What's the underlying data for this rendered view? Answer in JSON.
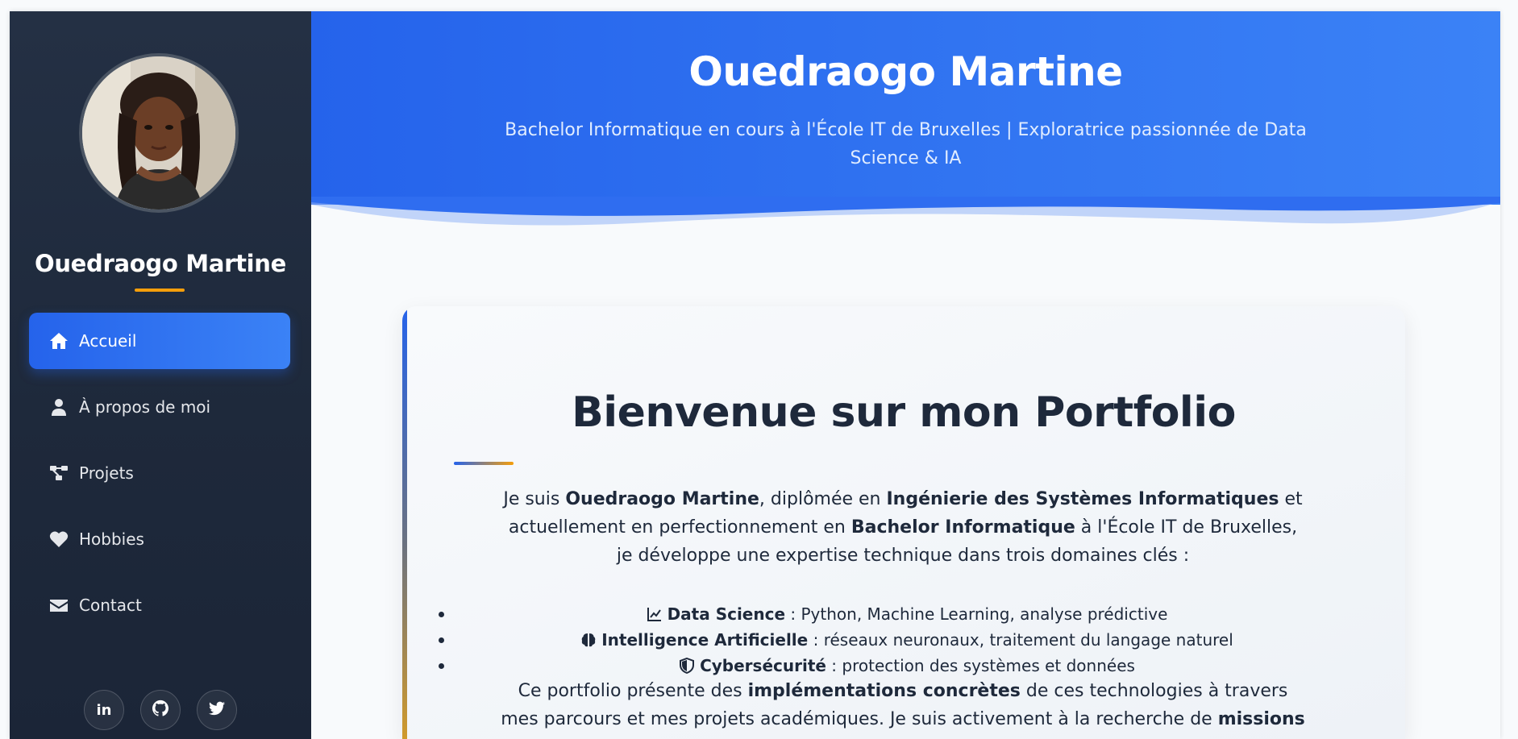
{
  "sidebar": {
    "name": "Ouedraogo Martine",
    "nav": [
      {
        "label": "Accueil",
        "icon": "home-icon",
        "active": true
      },
      {
        "label": "À propos de moi",
        "icon": "user-icon",
        "active": false
      },
      {
        "label": "Projets",
        "icon": "project-diagram-icon",
        "active": false
      },
      {
        "label": "Hobbies",
        "icon": "heart-icon",
        "active": false
      },
      {
        "label": "Contact",
        "icon": "envelope-icon",
        "active": false
      }
    ],
    "socials": [
      {
        "label": "in",
        "icon": "linkedin-icon"
      },
      {
        "label": "",
        "icon": "github-icon"
      },
      {
        "label": "",
        "icon": "twitter-icon"
      }
    ]
  },
  "header": {
    "title": "Ouedraogo Martine",
    "subtitle": "Bachelor Informatique en cours à l'École IT de Bruxelles | Exploratrice passionnée de Data Science & IA"
  },
  "main": {
    "heading": "Bienvenue sur mon Portfolio",
    "intro": {
      "p1": "Je suis ",
      "name": "Ouedraogo Martine",
      "p2": ", diplômée en ",
      "degree": "Ingénierie des Systèmes Informatiques",
      "p3": " et actuellement en perfectionnement en ",
      "bachelor": "Bachelor Informatique",
      "p4": " à l'École IT de Bruxelles, je développe une expertise technique dans trois domaines clés :"
    },
    "skills": [
      {
        "icon": "chart-line-icon",
        "title": "Data Science",
        "desc": " : Python, Machine Learning, analyse prédictive"
      },
      {
        "icon": "brain-icon",
        "title": "Intelligence Artificielle",
        "desc": " : réseaux neuronaux, traitement du langage naturel"
      },
      {
        "icon": "shield-icon",
        "title": "Cybersécurité",
        "desc": " : protection des systèmes et données"
      }
    ],
    "outro": {
      "p1": "Ce portfolio présente des ",
      "b1": "implémentations concrètes",
      "p2": " de ces technologies à travers mes parcours et mes projets académiques. Je suis activement à la recherche de ",
      "b2": "missions"
    }
  },
  "colors": {
    "sidebar_bg": "#1e293b",
    "accent_blue": "#2563eb",
    "accent_gold": "#f59e0b",
    "text_dark": "#1e293b"
  }
}
